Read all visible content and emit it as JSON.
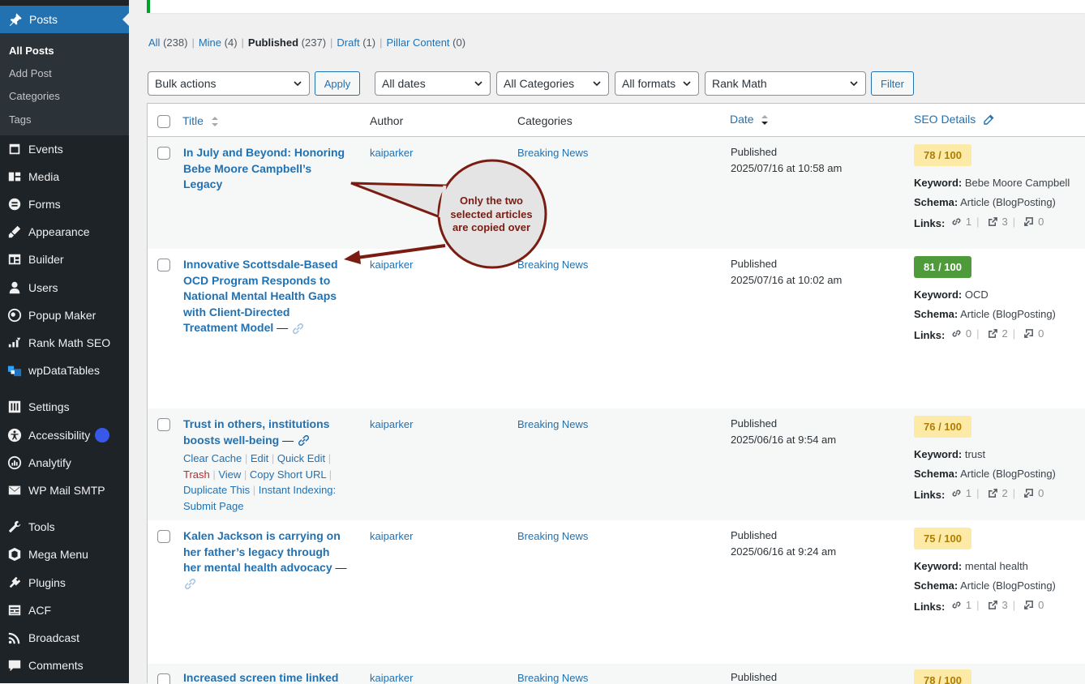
{
  "sidebar": {
    "posts_label": "Posts",
    "submenu": [
      "All Posts",
      "Add Post",
      "Categories",
      "Tags"
    ],
    "items": [
      {
        "label": "Events",
        "icon": "calendar-icon"
      },
      {
        "label": "Media",
        "icon": "media-icon"
      },
      {
        "label": "Forms",
        "icon": "forms-icon"
      },
      {
        "label": "Appearance",
        "icon": "appearance-brush-icon"
      },
      {
        "label": "Builder",
        "icon": "builder-icon"
      },
      {
        "label": "Users",
        "icon": "users-icon"
      },
      {
        "label": "Popup Maker",
        "icon": "popup-maker-icon"
      },
      {
        "label": "Rank Math SEO",
        "icon": "rank-math-icon"
      },
      {
        "label": "wpDataTables",
        "icon": "wpdatatables-icon"
      },
      {
        "label": "Settings",
        "icon": "settings-sliders-icon"
      },
      {
        "label": "Accessibility",
        "icon": "accessibility-icon"
      },
      {
        "label": "Analytify",
        "icon": "analytify-icon"
      },
      {
        "label": "WP Mail SMTP",
        "icon": "mail-icon"
      },
      {
        "label": "Tools",
        "icon": "wrench-icon"
      },
      {
        "label": "Mega Menu",
        "icon": "mega-menu-icon"
      },
      {
        "label": "Plugins",
        "icon": "plugin-plug-icon"
      },
      {
        "label": "ACF",
        "icon": "acf-icon"
      },
      {
        "label": "Broadcast",
        "icon": "rss-icon"
      },
      {
        "label": "Comments",
        "icon": "comment-bubble-icon"
      }
    ]
  },
  "views": {
    "all": "All",
    "all_count": "(238)",
    "mine": "Mine",
    "mine_count": "(4)",
    "published": "Published",
    "published_count": "(237)",
    "draft": "Draft",
    "draft_count": "(1)",
    "pillar": "Pillar Content",
    "pillar_count": "(0)"
  },
  "filters": {
    "bulk_actions": "Bulk actions",
    "apply": "Apply",
    "dates": "All dates",
    "categories": "All Categories",
    "formats": "All formats",
    "rank_math": "Rank Math",
    "filter": "Filter"
  },
  "columns": {
    "title": "Title",
    "author": "Author",
    "categories": "Categories",
    "date": "Date",
    "seo": "SEO Details"
  },
  "labels": {
    "keyword": "Keyword:",
    "schema": "Schema:",
    "links": "Links:",
    "dash": "—"
  },
  "row_actions": {
    "clear_cache": "Clear Cache",
    "edit": "Edit",
    "quick_edit": "Quick Edit",
    "trash": "Trash",
    "view": "View",
    "copy_short_url": "Copy Short URL",
    "duplicate": "Duplicate This",
    "instant_indexing": "Instant Indexing:",
    "submit_page": "Submit Page"
  },
  "posts": [
    {
      "title_lines": [
        "In July and Beyond: Honoring",
        "Bebe Moore Campbell’s",
        "Legacy"
      ],
      "author": "kaiparker",
      "category": "Breaking News",
      "status": "Published",
      "date": "2025/07/16 at 10:58 am",
      "score": "78 / 100",
      "keyword": "Bebe Moore Campbell",
      "schema": "Article (BlogPosting)",
      "links": [
        "1",
        "3",
        "0"
      ]
    },
    {
      "title_lines": [
        "Innovative Scottsdale-Based",
        "OCD Program Responds to",
        "National Mental Health Gaps",
        "with Client-Directed",
        "Treatment Model"
      ],
      "author": "kaiparker",
      "category": "Breaking News",
      "status": "Published",
      "date": "2025/07/16 at 10:02 am",
      "score": "81 / 100",
      "keyword": "OCD",
      "schema": "Article (BlogPosting)",
      "links": [
        "0",
        "2",
        "0"
      ]
    },
    {
      "title_lines": [
        "Trust in others, institutions",
        "boosts well-being"
      ],
      "author": "kaiparker",
      "category": "Breaking News",
      "status": "Published",
      "date": "2025/06/16 at 9:54 am",
      "score": "76 / 100",
      "keyword": "trust",
      "schema": "Article (BlogPosting)",
      "links": [
        "1",
        "2",
        "0"
      ]
    },
    {
      "title_lines": [
        "Kalen Jackson is carrying on",
        "her father’s legacy through",
        "her mental health advocacy"
      ],
      "author": "kaiparker",
      "category": "Breaking News",
      "status": "Published",
      "date": "2025/06/16 at 9:24 am",
      "score": "75 / 100",
      "keyword": "mental health",
      "schema": "Article (BlogPosting)",
      "links": [
        "1",
        "3",
        "0"
      ]
    },
    {
      "title_lines": [
        "Increased screen time linked"
      ],
      "author": "kaiparker",
      "category": "Breaking News",
      "status": "Published",
      "score": "78 / 100"
    }
  ],
  "callout": {
    "lines": [
      "Only the two",
      "selected articles",
      "are copied over"
    ]
  },
  "colors": {
    "admin_bar": "#1d2327",
    "accent": "#2271b1",
    "score_yellow": "#fdeaa7",
    "score_green": "#4f9b3c",
    "callout_border": "#7a1c12",
    "callout_fill": "#e4e4e4"
  }
}
